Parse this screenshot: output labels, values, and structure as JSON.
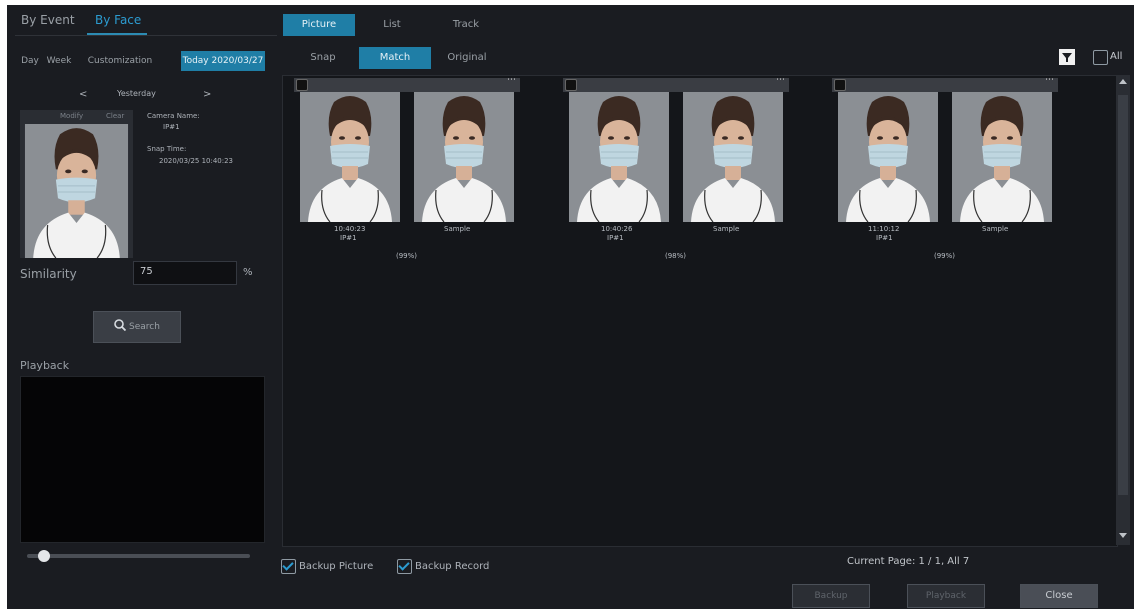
{
  "left_tabs": [
    "By Event",
    "By Face"
  ],
  "left_active_tab": 1,
  "date_filters": [
    "Day",
    "Week",
    "Customization",
    "Today 2020/03/27"
  ],
  "date_active": 3,
  "day_nav": {
    "prev": "<",
    "label": "Yesterday",
    "next": ">"
  },
  "face_subtabs": [
    "Modify",
    "Clear"
  ],
  "camera_label": "Camera Name:",
  "camera_value": "IP#1",
  "snap_label": "Snap Time:",
  "snap_value": "2020/03/25 10:40:23",
  "similarity_label": "Similarity",
  "similarity_value": "75",
  "similarity_unit": "%",
  "search_label": "Search",
  "playback_label": "Playback",
  "view_tabs": [
    "Picture",
    "List",
    "Track"
  ],
  "view_active": 0,
  "match_tabs": [
    "Snap",
    "Match",
    "Original"
  ],
  "match_active": 1,
  "all_label": "All",
  "cards": [
    {
      "time": "10:40:23",
      "camera": "IP#1",
      "sample": "Sample",
      "score": "(99%)"
    },
    {
      "time": "10:40:26",
      "camera": "IP#1",
      "sample": "Sample",
      "score": "(98%)"
    },
    {
      "time": "11:10:12",
      "camera": "IP#1",
      "sample": "Sample",
      "score": "(99%)"
    }
  ],
  "backup_picture_label": "Backup Picture",
  "backup_record_label": "Backup Record",
  "page_info": "Current Page: 1 / 1, All 7",
  "buttons": {
    "backup": "Backup",
    "playback": "Playback",
    "close": "Close"
  },
  "playback_progress": 0.05,
  "colors": {
    "accent": "#1f7ea6",
    "background": "#1a1c21",
    "panel": "#14161a"
  }
}
